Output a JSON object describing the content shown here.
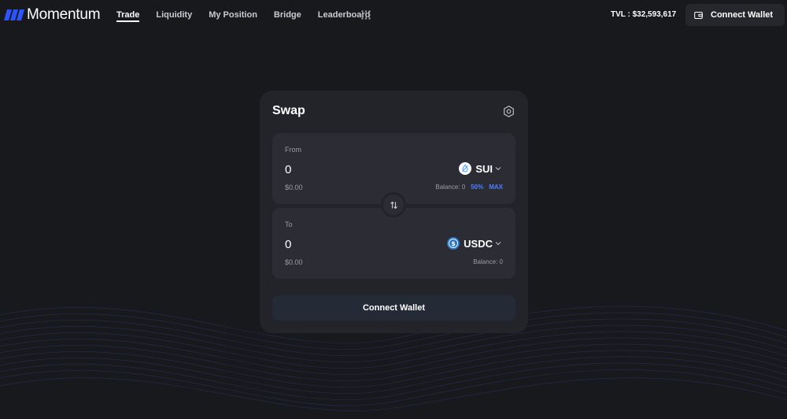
{
  "header": {
    "brand": "Momentum",
    "nav": [
      {
        "label": "Trade",
        "active": true
      },
      {
        "label": "Liquidity",
        "active": false
      },
      {
        "label": "My Position",
        "active": false
      },
      {
        "label": "Bridge",
        "active": false
      },
      {
        "label": "Leaderboard",
        "active": false
      }
    ],
    "more_icon": "grid-dots-icon",
    "tvl": "TVL : $32,593,617",
    "connect_label": "Connect Wallet",
    "connect_icon": "wallet-icon"
  },
  "swap": {
    "title": "Swap",
    "settings_icon": "settings-hex-icon",
    "from": {
      "label": "From",
      "amount": "0",
      "usd": "$0.00",
      "token": "SUI",
      "balance": "Balance: 0",
      "half": "50%",
      "max": "MAX"
    },
    "to": {
      "label": "To",
      "amount": "0",
      "usd": "$0.00",
      "token": "USDC",
      "balance": "Balance: 0"
    },
    "flip_icon": "swap-arrows-icon",
    "connect_label": "Connect Wallet"
  },
  "colors": {
    "background": "#18191d",
    "card": "#23242a",
    "panel": "#2c2d34",
    "accent": "#4f7cff",
    "brand": "#2d55ff"
  }
}
